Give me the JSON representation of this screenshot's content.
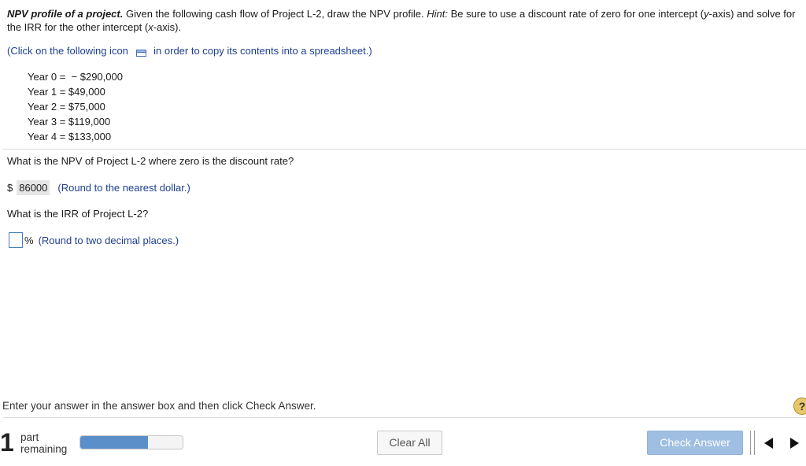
{
  "problem": {
    "title": "NPV profile of a project.",
    "text1": " Given the following cash flow of Project L-2, draw the NPV profile. ",
    "hint_label": "Hint:",
    "text2": " Be sure to use a discount rate of zero for one intercept (",
    "y_axis": "y",
    "text3": "-axis) and solve for the IRR for the other intercept (",
    "x_axis": "x",
    "text4": "-axis)."
  },
  "copy_instruction": {
    "before": "(Click on the following icon",
    "after": "in order to copy its contents into a spreadsheet.)",
    "icon": "copy-spreadsheet-icon"
  },
  "cash_flows": [
    "Year 0 =  − $290,000",
    "Year 1 = $49,000",
    "Year 2 = $75,000",
    "Year 3 = $119,000",
    "Year 4 = $133,000"
  ],
  "question1": {
    "text": "What is the NPV of Project L-2 where zero is the discount rate?",
    "currency": "$",
    "answer": "86000",
    "note": "(Round to the nearest dollar.)"
  },
  "question2": {
    "text": "What is the IRR of Project L-2?",
    "answer": "",
    "unit": "%",
    "note": "(Round to two decimal places.)"
  },
  "footer": {
    "instructions": "Enter your answer in the answer box and then click Check Answer.",
    "help_label": "?",
    "parts_count": "1",
    "parts_label_line1": "part",
    "parts_label_line2": "remaining",
    "progress_fraction": 0.66,
    "clear_label": "Clear All",
    "check_label": "Check Answer"
  },
  "colors": {
    "accent": "#1f3f8f",
    "progress_fill": "#5b8fc9",
    "check_button": "#9fbfe2"
  }
}
